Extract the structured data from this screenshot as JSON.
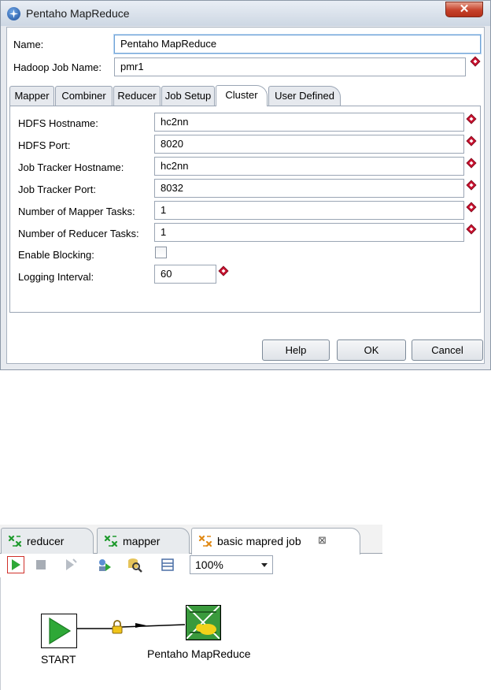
{
  "dialog": {
    "title": "Pentaho MapReduce",
    "close_label": "✕",
    "name_label": "Name:",
    "name_value": "Pentaho MapReduce",
    "job_name_label": "Hadoop Job Name:",
    "job_name_value": "pmr1",
    "tabs": [
      {
        "label": "Mapper"
      },
      {
        "label": "Combiner"
      },
      {
        "label": "Reducer"
      },
      {
        "label": "Job Setup"
      },
      {
        "label": "Cluster"
      },
      {
        "label": "User Defined"
      }
    ],
    "active_tab": "Cluster",
    "cluster": {
      "hdfs_host_label": "HDFS Hostname:",
      "hdfs_host_value": "hc2nn",
      "hdfs_port_label": "HDFS Port:",
      "hdfs_port_value": "8020",
      "jt_host_label": "Job Tracker Hostname:",
      "jt_host_value": "hc2nn",
      "jt_port_label": "Job Tracker Port:",
      "jt_port_value": "8032",
      "mappers_label": "Number of Mapper Tasks:",
      "mappers_value": "1",
      "reducers_label": "Number of Reducer Tasks:",
      "reducers_value": "1",
      "blocking_label": "Enable Blocking:",
      "blocking_checked": false,
      "interval_label": "Logging Interval:",
      "interval_value": "60"
    },
    "buttons": {
      "help": "Help",
      "ok": "OK",
      "cancel": "Cancel"
    },
    "colors": {
      "variable_icon": "#c8102e",
      "title_bar": "#cdd7e3",
      "close": "#c6422b"
    }
  },
  "editor": {
    "tabs": [
      {
        "label": "reducer",
        "icon": "transformation-icon"
      },
      {
        "label": "mapper",
        "icon": "transformation-icon"
      },
      {
        "label": "basic mapred job",
        "icon": "job-icon"
      }
    ],
    "active_tab": "basic mapred job",
    "zoom": "100%",
    "nodes": {
      "start": "START",
      "mapreduce": "Pentaho MapReduce"
    }
  }
}
